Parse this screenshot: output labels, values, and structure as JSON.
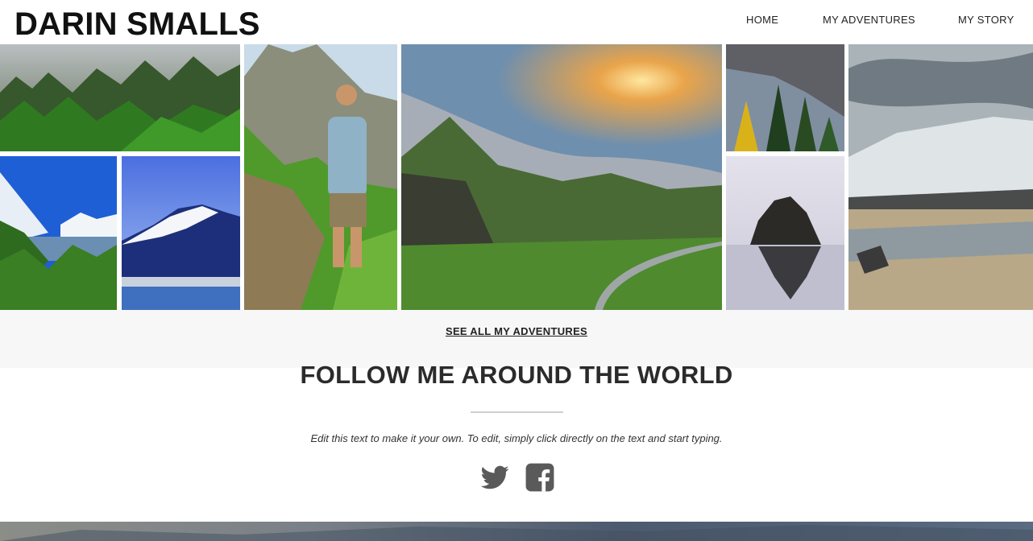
{
  "header": {
    "site_title": "DARIN SMALLS",
    "nav": [
      "HOME",
      "MY ADVENTURES",
      "MY STORY"
    ]
  },
  "gallery": {
    "photos": [
      "misty-forest-photo",
      "snowy-lake-photo",
      "snow-mountain-photo",
      "hiker-mountain-photo",
      "green-valley-sunset-photo",
      "autumn-trees-photo",
      "sea-rock-photo",
      "glacier-lake-photo"
    ]
  },
  "cta": {
    "see_all": "SEE ALL MY ADVENTURES"
  },
  "follow": {
    "title": "FOLLOW ME AROUND THE WORLD",
    "text": "Edit this text to make it your own. To edit, simply click directly on the text and start typing.",
    "social": [
      "twitter-icon",
      "facebook-icon"
    ]
  },
  "colors": {
    "icon": "#5a5a5a",
    "band": "#f7f7f7",
    "title": "#2b2b2b"
  }
}
